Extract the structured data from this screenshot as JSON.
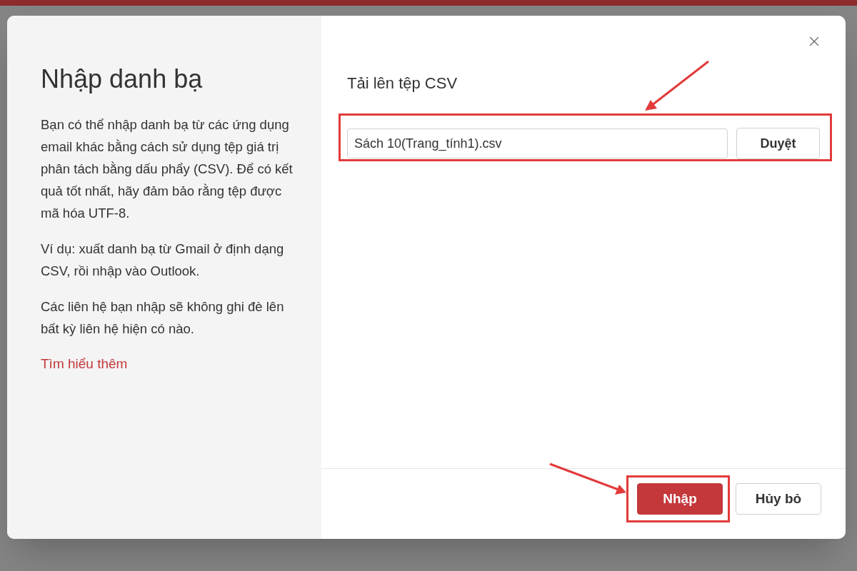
{
  "dialog": {
    "title": "Nhập danh bạ",
    "paragraphs": [
      "Bạn có thể nhập danh bạ từ các ứng dụng email khác bằng cách sử dụng tệp giá trị phân tách bằng dấu phẩy (CSV). Để có kết quả tốt nhất, hãy đảm bảo rằng tệp được mã hóa UTF-8.",
      "Ví dụ: xuất danh bạ từ Gmail ở định dạng CSV, rồi nhập vào Outlook.",
      "Các liên hệ bạn nhập sẽ không ghi đè lên bất kỳ liên hệ hiện có nào."
    ],
    "link": "Tìm hiểu thêm",
    "upload_heading": "Tải lên tệp CSV",
    "file_field": {
      "value": "Sách 10(Trang_tính1).csv"
    },
    "browse_button": "Duyệt",
    "buttons": [
      {
        "label": "Nhập",
        "kind": "primary"
      },
      {
        "label": "Hủy bỏ",
        "kind": "secondary"
      }
    ]
  }
}
